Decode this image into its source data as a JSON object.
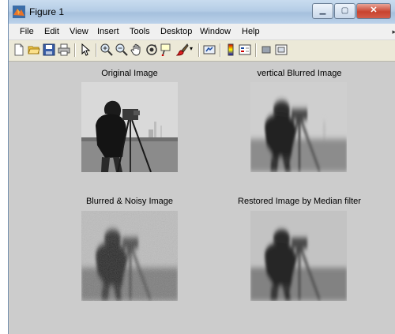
{
  "window": {
    "title": "Figure 1"
  },
  "menu": [
    "File",
    "Edit",
    "View",
    "Insert",
    "Tools",
    "Desktop",
    "Window",
    "Help"
  ],
  "toolbar": [
    "new-figure-icon",
    "open-file-icon",
    "save-icon",
    "print-icon",
    "edit-plot-arrow-icon",
    "zoom-in-icon",
    "zoom-out-icon",
    "pan-hand-icon",
    "rotate-3d-icon",
    "data-cursor-icon",
    "brush-icon",
    "link-plot-icon",
    "colorbar-icon",
    "legend-icon",
    "hide-plot-tools-icon",
    "show-plot-tools-icon"
  ],
  "subplots": [
    {
      "title": "Original Image"
    },
    {
      "title": "vertical Blurred Image"
    },
    {
      "title": "Blurred & Noisy Image"
    },
    {
      "title": "Restored Image by Median filter"
    }
  ],
  "colors": {
    "figure_bg": "#cccccc",
    "titlebar": "#b5cde6",
    "close_button": "#c8432f"
  }
}
